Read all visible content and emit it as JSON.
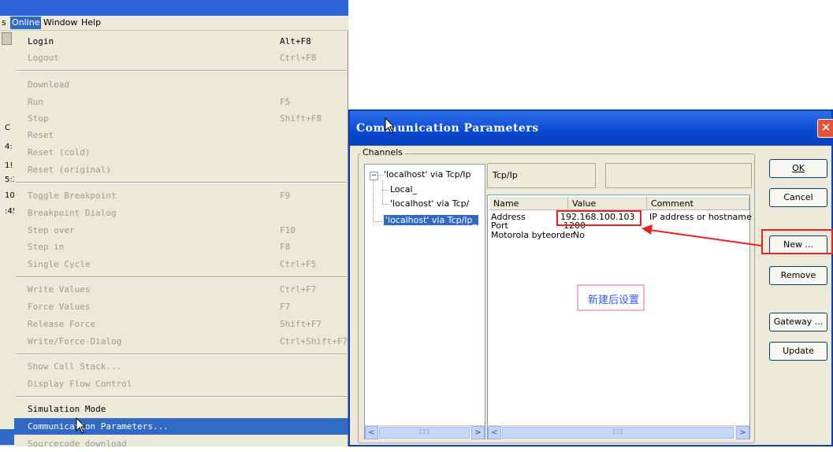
{
  "menubar": {
    "items": [
      {
        "label": "s",
        "selected": false
      },
      {
        "label": "Online",
        "selected": true
      },
      {
        "label": "Window",
        "selected": false
      },
      {
        "label": "Help",
        "selected": false
      }
    ]
  },
  "left_fragments": [
    "C",
    "4:",
    "1!",
    "5:3",
    "10",
    ":45"
  ],
  "online_menu": {
    "items": [
      {
        "label": "Login",
        "accel": "Alt+F8",
        "enabled": true
      },
      {
        "label": "Logout",
        "accel": "Ctrl+F8",
        "enabled": false
      },
      {
        "label": "Download",
        "accel": "",
        "enabled": false
      },
      {
        "label": "Run",
        "accel": "F5",
        "enabled": false
      },
      {
        "label": "Stop",
        "accel": "Shift+F8",
        "enabled": false
      },
      {
        "label": "Reset",
        "accel": "",
        "enabled": false
      },
      {
        "label": "Reset (cold)",
        "accel": "",
        "enabled": false
      },
      {
        "label": "Reset (original)",
        "accel": "",
        "enabled": false
      },
      {
        "label": "Toggle Breakpoint",
        "accel": "F9",
        "enabled": false
      },
      {
        "label": "Breakpoint Dialog",
        "accel": "",
        "enabled": false
      },
      {
        "label": "Step over",
        "accel": "F10",
        "enabled": false
      },
      {
        "label": "Step in",
        "accel": "F8",
        "enabled": false
      },
      {
        "label": "Single Cycle",
        "accel": "Ctrl+F5",
        "enabled": false
      },
      {
        "label": "Write Values",
        "accel": "Ctrl+F7",
        "enabled": false
      },
      {
        "label": "Force Values",
        "accel": "F7",
        "enabled": false
      },
      {
        "label": "Release Force",
        "accel": "Shift+F7",
        "enabled": false
      },
      {
        "label": "Write/Force-Dialog",
        "accel": "Ctrl+Shift+F7",
        "enabled": false
      },
      {
        "label": "Show Call Stack...",
        "accel": "",
        "enabled": false
      },
      {
        "label": "Display Flow Control",
        "accel": "",
        "enabled": false
      },
      {
        "label": "Simulation Mode",
        "accel": "",
        "enabled": true
      },
      {
        "label": "Communication Parameters...",
        "accel": "",
        "enabled": true,
        "highlighted": true
      },
      {
        "label": "Sourcecode download",
        "accel": "",
        "enabled": false
      }
    ]
  },
  "dialog": {
    "title": "Communication Parameters",
    "close_glyph": "✕",
    "channels_label": "Channels",
    "tree": {
      "root": "'localhost' via Tcp/Ip",
      "children": [
        "Local_",
        "'localhost' via Tcp/"
      ],
      "selected": "'localhost' via Tcp/Ip_",
      "expander": "−"
    },
    "protocol_field": "Tcp/Ip",
    "name_field": "",
    "grid": {
      "columns": [
        "Name",
        "Value",
        "Comment"
      ],
      "rows": [
        {
          "name": "Address",
          "value": "192.168.100.103",
          "comment": "IP address or hostname"
        },
        {
          "name": "Port",
          "value": "1200",
          "comment": ""
        },
        {
          "name": "Motorola byteorder",
          "value": "No",
          "comment": ""
        }
      ]
    },
    "buttons": {
      "ok": "OK",
      "cancel": "Cancel",
      "new": "New ...",
      "remove": "Remove",
      "gateway": "Gateway ...",
      "update": "Update"
    },
    "scroll_glyphs": {
      "left": "<",
      "right": ">",
      "thumb": "III"
    }
  },
  "annotation": {
    "text": "新建后设置",
    "text_color": "#3355ff",
    "box_border_color": "#f3b3c7",
    "highlight_color": "#e52421"
  }
}
